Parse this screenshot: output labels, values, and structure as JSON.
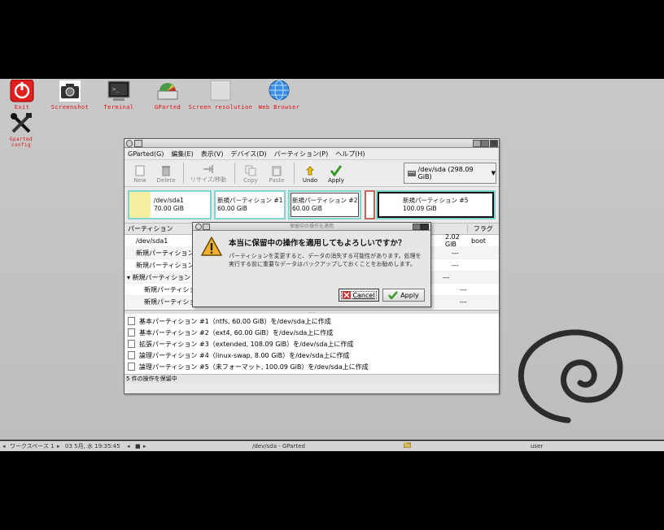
{
  "desktop": {
    "icons": [
      {
        "id": "exit",
        "label": "Exit"
      },
      {
        "id": "screenshot",
        "label": "Screenshot"
      },
      {
        "id": "terminal",
        "label": "Terminal"
      },
      {
        "id": "gparted",
        "label": "GParted"
      },
      {
        "id": "screen_resolution",
        "label": "Screen resolution"
      },
      {
        "id": "web_browser",
        "label": "Web Browser"
      },
      {
        "id": "gparted_config",
        "label": "Gparted config"
      }
    ]
  },
  "window": {
    "menu": [
      "GParted(G)",
      "編集(E)",
      "表示(V)",
      "デバイス(D)",
      "パーティション(P)",
      "ヘルプ(H)"
    ],
    "toolbar": {
      "new": "New",
      "delete": "Delete",
      "resize": "リサイズ/移動",
      "copy": "Copy",
      "paste": "Paste",
      "undo": "Undo",
      "apply": "Apply"
    },
    "device_selector": "/dev/sda  (298.09 GiB)",
    "partition_map": [
      {
        "name": "/dev/sda1",
        "size": "70.00 GiB"
      },
      {
        "name": "新規パーティション #1",
        "size": "60.00 GiB"
      },
      {
        "name": "新規パーティション #2",
        "size": "60.00 GiB"
      },
      {
        "name": "新規パーティション #5",
        "size": "100.09 GiB"
      }
    ],
    "table": {
      "header_partition": "パーティション",
      "header_unused": "き",
      "header_flags": "フラグ",
      "rows": [
        {
          "partition": "/dev/sda1",
          "unused": "2.02 GiB",
          "flags": "boot"
        },
        {
          "partition": "新規パーティション",
          "unused": "---",
          "flags": ""
        },
        {
          "partition": "新規パーティション",
          "unused": "---",
          "flags": ""
        },
        {
          "partition": "新規パーティション",
          "unused": "---",
          "flags": ""
        },
        {
          "partition": "新規パーティション",
          "unused": "---",
          "flags": ""
        },
        {
          "partition": "新規パーティション",
          "unused": "---",
          "flags": ""
        }
      ]
    },
    "operations": [
      "基本パーティション #1（ntfs, 60.00 GiB）を/dev/sda上に作成",
      "基本パーティション #2（ext4, 60.00 GiB）を/dev/sda上に作成",
      "拡張パーティション #3（extended, 108.09 GiB）を/dev/sda上に作成",
      "論理パーティション #4（linux-swap, 8.00 GiB）を/dev/sda上に作成",
      "論理パーティション #5（未フォーマット, 100.09 GiB）を/dev/sda上に作成"
    ],
    "status": "5 件の操作を保留中"
  },
  "dialog": {
    "title": "保留中の操作を適用",
    "heading": "本当に保留中の操作を適用してもよろしいですか？",
    "body": "パーティションを変更すると、データの消失する可能性があります。処理を実行する前に重要なデータはバックアップしておくことをお勧めします。",
    "cancel": "Cancel",
    "apply": "Apply"
  },
  "taskbar": {
    "workspace": "ワークスペース 1",
    "datetime": "03 5月, 水 19:35:45",
    "window_title": "/dev/sda - GParted",
    "user": "user"
  },
  "colors": {
    "accent": "#7fd4cf",
    "swap": "#c1665a",
    "ntfs": "#f5f0a0"
  }
}
